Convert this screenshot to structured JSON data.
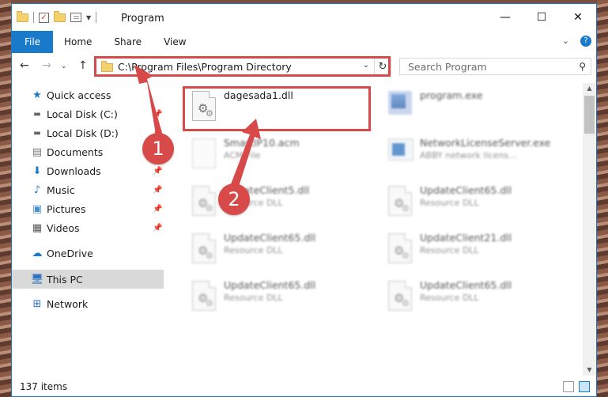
{
  "window": {
    "title": "Program"
  },
  "ribbon": {
    "tabs": [
      {
        "label": "File",
        "active": true
      },
      {
        "label": "Home"
      },
      {
        "label": "Share"
      },
      {
        "label": "View"
      }
    ]
  },
  "address": {
    "path": "C:\\Program Files\\Program Directory",
    "search_placeholder": "Search Program"
  },
  "sidebar": {
    "items": [
      {
        "label": "Quick access",
        "icon": "star-icon",
        "pinned": false
      },
      {
        "label": "Local Disk (C:)",
        "icon": "drive-icon",
        "pinned": true
      },
      {
        "label": "Local Disk (D:)",
        "icon": "drive-icon",
        "pinned": true
      },
      {
        "label": "Documents",
        "icon": "documents-icon",
        "pinned": true
      },
      {
        "label": "Downloads",
        "icon": "download-icon",
        "pinned": true
      },
      {
        "label": "Music",
        "icon": "music-icon",
        "pinned": true
      },
      {
        "label": "Pictures",
        "icon": "pictures-icon",
        "pinned": true
      },
      {
        "label": "Videos",
        "icon": "videos-icon",
        "pinned": true
      },
      {
        "label": "OneDrive",
        "icon": "cloud-icon",
        "pinned": false
      },
      {
        "label": "This PC",
        "icon": "computer-icon",
        "selected": true
      },
      {
        "label": "Network",
        "icon": "network-icon",
        "pinned": false
      }
    ]
  },
  "files": [
    {
      "name": "dagesada1.dll",
      "sub": "",
      "icon": "dll-gear-icon",
      "highlighted": true
    },
    {
      "name": "program.exe",
      "sub": "",
      "icon": "program-icon",
      "blurred": true
    },
    {
      "name": "SmartIP10.acm",
      "sub": "ACM File",
      "icon": "acm-file-icon",
      "blurred": true
    },
    {
      "name": "NetworkLicenseServer.exe",
      "sub": "ABBY network licens...",
      "icon": "exe-icon",
      "blurred": true
    },
    {
      "name": "UpdateClient5.dll",
      "sub": "Resource DLL",
      "icon": "dll-gear-icon",
      "blurred": true
    },
    {
      "name": "UpdateClient65.dll",
      "sub": "Resource DLL",
      "icon": "dll-gear-icon",
      "blurred": true
    },
    {
      "name": "UpdateClient65.dll",
      "sub": "Resource DLL",
      "icon": "dll-gear-icon",
      "blurred": true
    },
    {
      "name": "UpdateClient21.dll",
      "sub": "Resource DLL",
      "icon": "dll-gear-icon",
      "blurred": true
    },
    {
      "name": "UpdateClient65.dll",
      "sub": "Resource DLL",
      "icon": "dll-gear-icon",
      "blurred": true
    },
    {
      "name": "UpdateClient65.dll",
      "sub": "Resource DLL",
      "icon": "dll-gear-icon",
      "blurred": true
    }
  ],
  "status": {
    "count": "137 items"
  },
  "callouts": [
    {
      "label": "1"
    },
    {
      "label": "2"
    }
  ],
  "colors": {
    "accent": "#1979ca",
    "highlight": "#d84a4a",
    "selected": "#d9d9d9"
  }
}
